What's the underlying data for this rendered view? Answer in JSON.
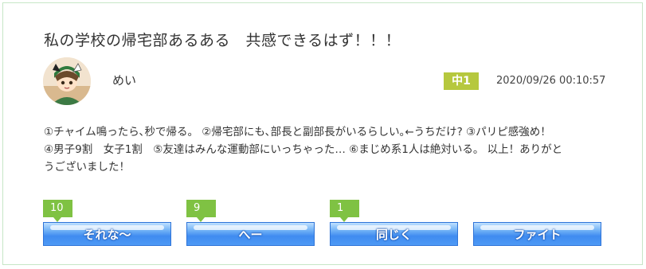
{
  "post": {
    "title": "私の学校の帰宅部あるある　共感できるはず！！！",
    "author": "めい",
    "grade": "中1",
    "timestamp": "2020/09/26 00:10:57",
    "body_lines": [
      "①チャイム鳴ったら､秒で帰る。 ②帰宅部にも､部長と副部長がいるらしい｡←うちだけ? ③パリピ感強め！",
      "④男子9割　女子1割　⑤友達はみんな運動部にいっちゃった… ⑥まじめ系1人は絶対いる。 以上！ありがと",
      "うございました！"
    ]
  },
  "reactions": [
    {
      "label": "それな～",
      "count": "10"
    },
    {
      "label": "へー",
      "count": "9"
    },
    {
      "label": "同じく",
      "count": "1"
    },
    {
      "label": "ファイト",
      "count": ""
    }
  ],
  "colors": {
    "card_border": "#c6e6c6",
    "grade_badge": "#b6c83e",
    "count_badge": "#7fc243",
    "button_blue": "#3f8bf0"
  },
  "icons": {
    "avatar": "anime-girl-avatar"
  }
}
